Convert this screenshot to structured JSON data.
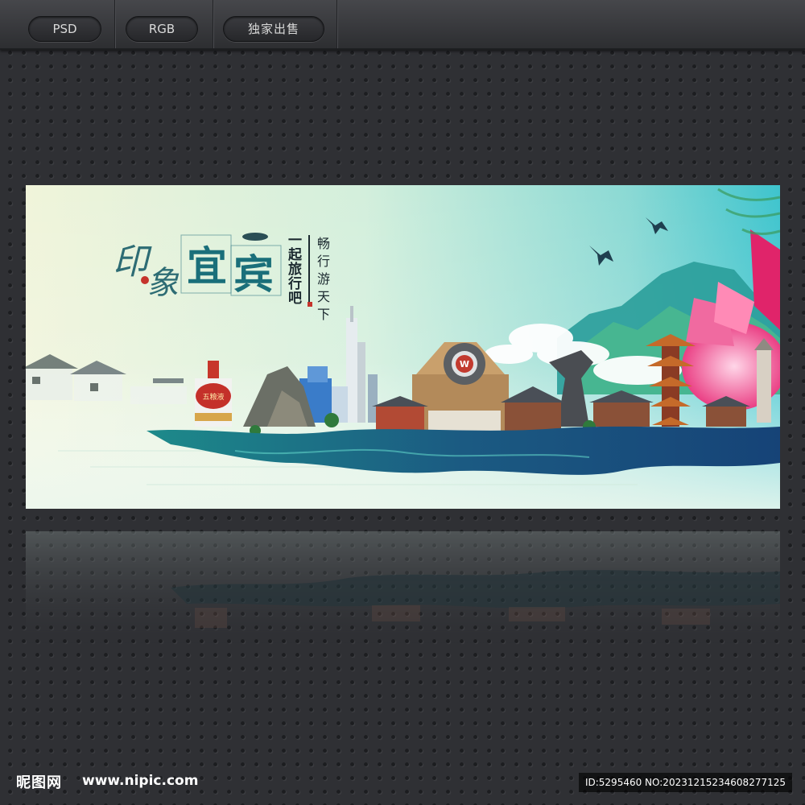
{
  "toolbar": {
    "tabs": [
      {
        "label": "PSD"
      },
      {
        "label": "RGB"
      },
      {
        "label": "独家出售"
      }
    ]
  },
  "banner": {
    "title_chars": [
      "印",
      "象",
      "宜",
      "宾"
    ],
    "slogan_chars": [
      "一",
      "起",
      "旅",
      "行",
      "吧"
    ],
    "motto_chars": [
      "畅",
      "行",
      "游",
      "天",
      "下"
    ],
    "badge_letter": "W",
    "bottle_label": "五粮液",
    "colors": {
      "sky_top": "#e9f3d8",
      "sky_right": "#43c4cc",
      "ink": "#1a6f7a",
      "wave": "#1c4a7a",
      "lotus": "#ef5f9a"
    }
  },
  "footer": {
    "logo": "昵图网",
    "url": "www.nipic.com",
    "id_text": "ID:5295460 NO:20231215234608277125"
  }
}
